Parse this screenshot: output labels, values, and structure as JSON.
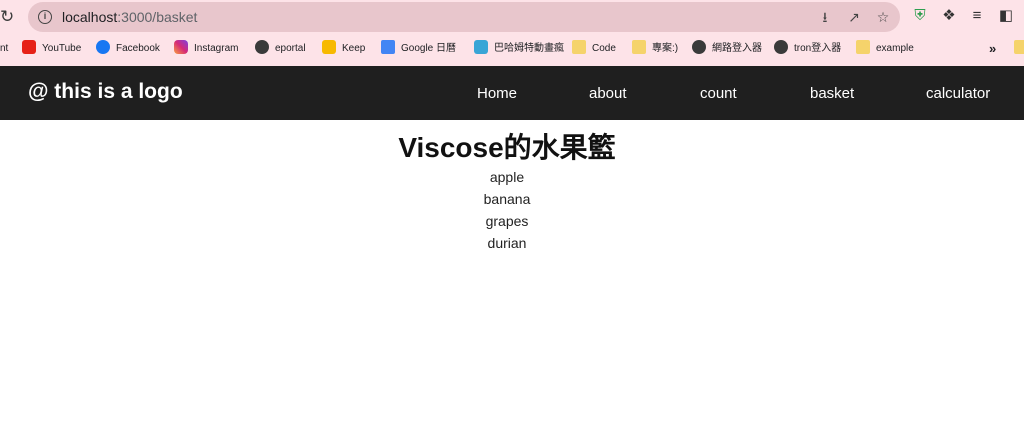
{
  "browser": {
    "url_host": "localhost",
    "url_rest": ":3000/basket",
    "bookmarks": [
      {
        "label": "nt",
        "icon": "globe-icon"
      },
      {
        "label": "YouTube",
        "icon": "youtube-icon"
      },
      {
        "label": "Facebook",
        "icon": "facebook-icon"
      },
      {
        "label": "Instagram",
        "icon": "instagram-icon"
      },
      {
        "label": "eportal",
        "icon": "globe-icon"
      },
      {
        "label": "Keep",
        "icon": "keep-icon"
      },
      {
        "label": "Google 日曆",
        "icon": "calendar-icon"
      },
      {
        "label": "巴哈姆特動畫瘋",
        "icon": "bahamut-icon"
      },
      {
        "label": "Code",
        "icon": "folder-icon"
      },
      {
        "label": "專案:)",
        "icon": "folder-icon"
      },
      {
        "label": "網路登入器",
        "icon": "globe-icon"
      },
      {
        "label": "tron登入器",
        "icon": "globe-icon"
      },
      {
        "label": "example",
        "icon": "folder-icon"
      }
    ],
    "overflow": "»"
  },
  "navbar": {
    "logo": "@ this is a logo",
    "links": [
      "Home",
      "about",
      "count",
      "basket",
      "calculator"
    ]
  },
  "main": {
    "title": "Viscose的水果籃",
    "fruits": [
      "apple",
      "banana",
      "grapes",
      "durian"
    ]
  }
}
